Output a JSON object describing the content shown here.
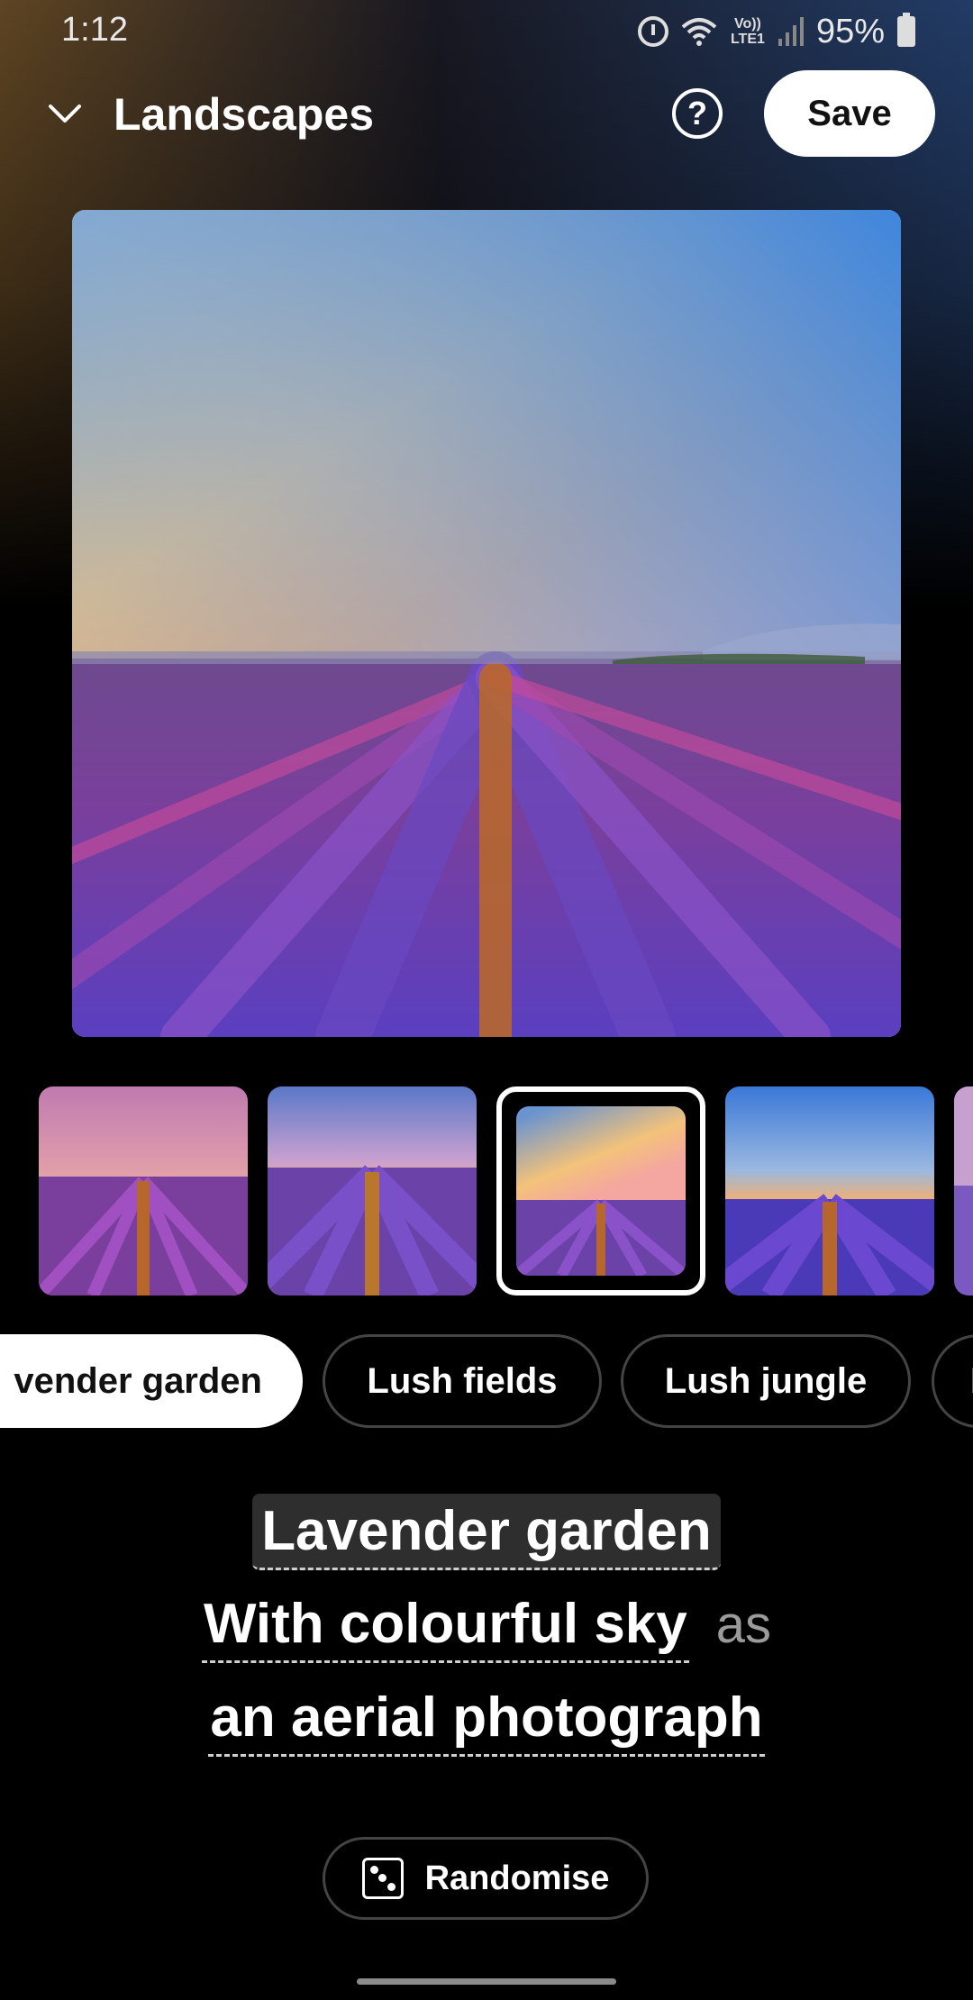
{
  "status_bar": {
    "time": "1:12",
    "lte_label": "Vo)) LTE1",
    "battery": "95%",
    "icons": [
      "alarm-icon",
      "wifi-icon",
      "lte-icon",
      "signal-icon",
      "battery-icon"
    ]
  },
  "header": {
    "collapse_icon": "chevron-down-icon",
    "title": "Landscapes",
    "help_label": "?",
    "save_label": "Save"
  },
  "thumbnails": [
    {
      "name": "thumbnail-1",
      "selected": false
    },
    {
      "name": "thumbnail-2",
      "selected": false
    },
    {
      "name": "thumbnail-3",
      "selected": true
    },
    {
      "name": "thumbnail-4",
      "selected": false
    },
    {
      "name": "thumbnail-5",
      "selected": false
    }
  ],
  "chips": [
    {
      "label": "vender garden",
      "active": true
    },
    {
      "label": "Lush fields",
      "active": false
    },
    {
      "label": "Lush jungle",
      "active": false
    },
    {
      "label": "L",
      "active": false
    }
  ],
  "prompt": {
    "subject": "Lavender garden",
    "modifier": "With colourful sky",
    "connector": "as",
    "style": "an aerial photograph"
  },
  "randomise": {
    "label": "Randomise",
    "icon": "dice-icon"
  },
  "colors": {
    "background": "#000000",
    "save_button_bg": "#ffffff",
    "chip_border": "#444444",
    "connector_text": "#9a9a9a"
  }
}
